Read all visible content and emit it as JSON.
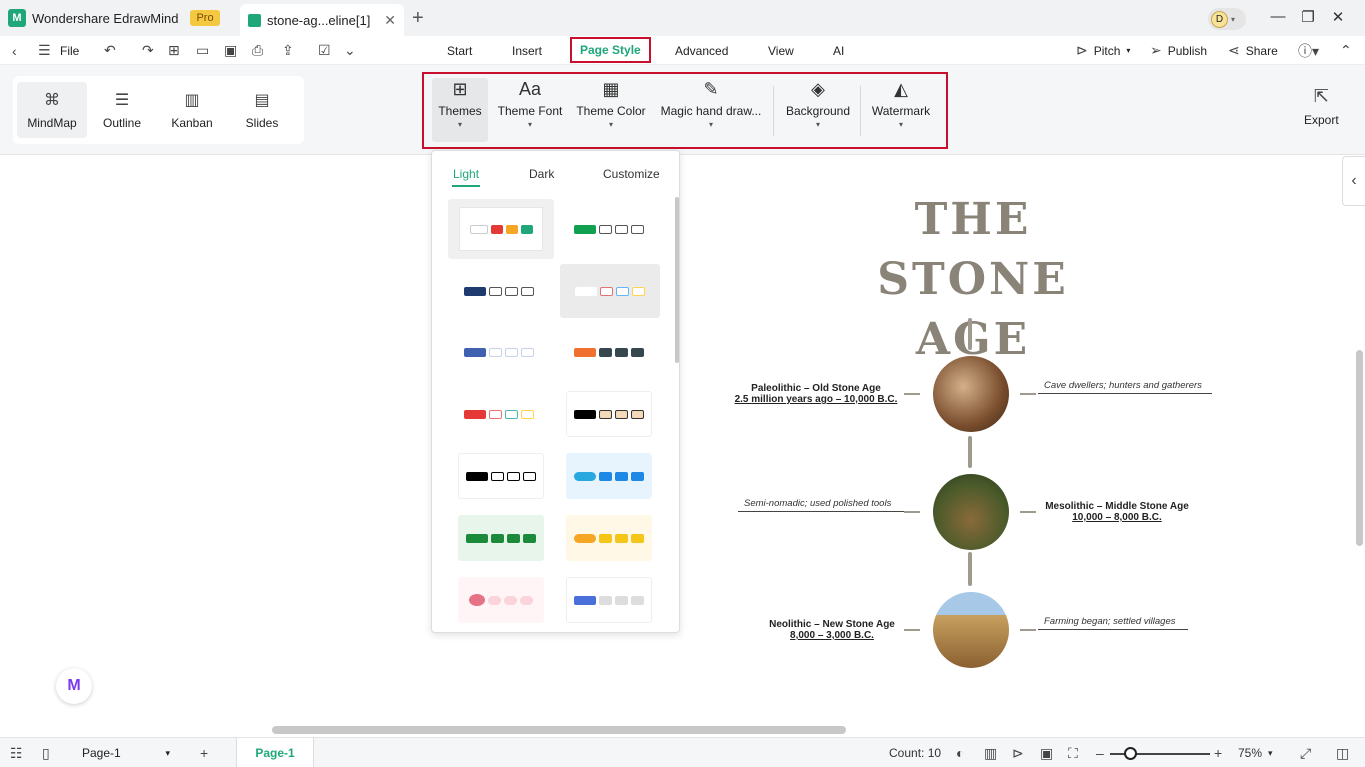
{
  "titlebar": {
    "app_name": "Wondershare EdrawMind",
    "pro_badge": "Pro",
    "doc_tab": "stone-ag...eline[1]",
    "avatar_initial": "D"
  },
  "menubar": {
    "file": "File",
    "tabs": [
      "Start",
      "Insert",
      "Page Style",
      "Advanced",
      "View",
      "AI"
    ],
    "active_tab": "Page Style",
    "pitch": "Pitch",
    "publish": "Publish",
    "share": "Share"
  },
  "views": [
    "MindMap",
    "Outline",
    "Kanban",
    "Slides"
  ],
  "style_tools": [
    "Themes",
    "Theme Font",
    "Theme Color",
    "Magic hand draw...",
    "Background",
    "Watermark"
  ],
  "export": "Export",
  "themes_panel": {
    "tabs": [
      "Light",
      "Dark",
      "Customize"
    ],
    "active_tab": "Light"
  },
  "mindmap": {
    "title_line1": "THE STONE",
    "title_line2": "AGE",
    "nodes": [
      {
        "title": "Paleolithic – Old Stone Age",
        "dates": "2.5 million years ago – 10,000 B.C.",
        "note": "Cave dwellers; hunters and gatherers"
      },
      {
        "title": "Mesolithic – Middle Stone Age",
        "dates": "10,000 – 8,000 B.C.",
        "note": "Semi-nomadic; used polished tools"
      },
      {
        "title": "Neolithic – New Stone Age",
        "dates": "8,000 – 3,000 B.C.",
        "note": "Farming began; settled villages"
      }
    ]
  },
  "statusbar": {
    "page_select": "Page-1",
    "page_tab": "Page-1",
    "count": "Count: 10",
    "zoom": "75%"
  },
  "colors": {
    "accent": "#1fa77a",
    "highlight": "#c8102e"
  }
}
